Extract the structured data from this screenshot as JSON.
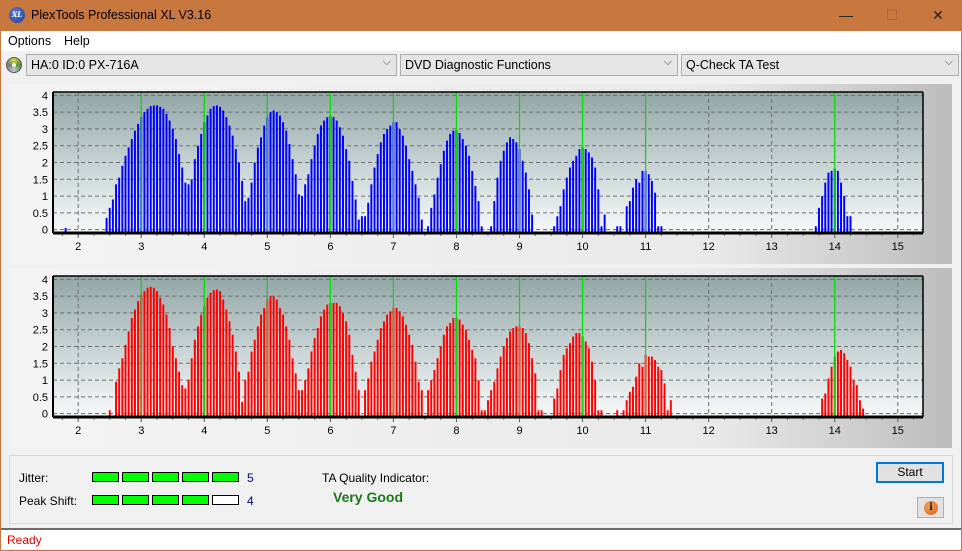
{
  "window": {
    "title": "PlexTools Professional XL V3.16",
    "app_icon_text": "XL",
    "minimize_glyph": "—",
    "maximize_glyph": "☐",
    "close_glyph": "✕"
  },
  "menu": {
    "items": [
      "Options",
      "Help"
    ]
  },
  "toolbar": {
    "drive_select": "HA:0 ID:0  PX-716A",
    "function_select": "DVD Diagnostic Functions",
    "test_select": "Q-Check TA Test",
    "chevron": "⌵"
  },
  "colors": {
    "land_bars": "#0000ff",
    "pit_bars": "#ff0000",
    "reference_lines": "#00e000",
    "quality_text": "#1a7a1a",
    "status_text": "#e00000"
  },
  "bottom": {
    "jitter_label": "Jitter:",
    "jitter_value": "5",
    "jitter_score": 5,
    "peak_shift_label": "Peak Shift:",
    "peak_shift_value": "4",
    "peak_shift_score": 4,
    "meter_max": 5,
    "ta_quality_label": "TA Quality Indicator:",
    "ta_quality_value": "Very Good",
    "start_label": "Start",
    "info_glyph": "i"
  },
  "status": {
    "text": "Ready"
  },
  "chart_data": [
    {
      "type": "bar",
      "name": "upper-ta-histogram",
      "color": "#0000ff",
      "xlim": [
        1.6,
        15.4
      ],
      "ylim": [
        -0.1,
        4.1
      ],
      "x_ticks": [
        "2",
        "3",
        "4",
        "5",
        "6",
        "7",
        "8",
        "9",
        "10",
        "11",
        "12",
        "13",
        "14",
        "15"
      ],
      "y_ticks": [
        "0",
        "0.5",
        "1",
        "1.5",
        "2",
        "2.5",
        "3",
        "3.5",
        "4"
      ],
      "reference_lines": [
        3,
        4,
        5,
        6,
        7,
        8,
        9,
        10,
        11,
        14
      ],
      "grid": true,
      "bar_step": 0.05,
      "peaks": [
        {
          "start": 1.8,
          "values": [
            0.05
          ]
        },
        {
          "start": 2.45,
          "values": [
            0.35,
            0.65,
            0.9,
            1.35,
            1.55,
            1.9,
            2.2,
            2.45,
            2.7,
            2.95,
            3.15,
            3.35,
            3.5,
            3.6,
            3.68,
            3.7,
            3.7,
            3.66,
            3.6,
            3.45,
            3.25,
            3.0,
            2.7,
            2.25,
            1.85,
            1.4,
            1.35,
            1.5,
            2.1,
            2.5,
            2.85,
            3.2,
            3.4,
            3.6,
            3.68,
            3.7,
            3.66,
            3.55,
            3.35,
            3.1,
            2.8,
            2.4,
            2.0,
            1.45,
            0.85,
            0.95,
            1.4,
            2.0,
            2.45,
            2.75,
            3.1,
            3.35,
            3.5,
            3.55,
            3.5,
            3.4,
            3.2,
            2.95,
            2.55,
            2.1,
            1.65,
            1.05,
            0.15
          ]
        },
        {
          "start": 5.55,
          "values": [
            1.0,
            1.35,
            1.65,
            2.1,
            2.5,
            2.85,
            3.1,
            3.25,
            3.35,
            3.38,
            3.35,
            3.25,
            3.05,
            2.8,
            2.4,
            2.05,
            1.45,
            0.9,
            0.3
          ]
        },
        {
          "start": 6.5,
          "values": [
            0.4,
            0.4,
            0.8,
            1.35,
            1.85,
            2.25,
            2.6,
            2.85,
            3.0,
            3.1,
            3.2,
            3.2,
            3.0,
            2.8,
            2.5,
            2.1,
            1.75,
            1.35,
            0.95,
            0.3
          ]
        },
        {
          "start": 7.55,
          "values": [
            0.1,
            0.65,
            1.05,
            1.55,
            1.95,
            2.35,
            2.65,
            2.85,
            2.95,
            2.96,
            2.88,
            2.7,
            2.5,
            2.2,
            1.75,
            1.3,
            0.85,
            0.1
          ]
        },
        {
          "start": 8.55,
          "values": [
            0.1,
            0.85,
            1.55,
            2.05,
            2.35,
            2.6,
            2.75,
            2.7,
            2.6,
            2.4,
            2.05,
            1.7,
            1.2,
            0.45
          ]
        },
        {
          "start": 9.55,
          "values": [
            0.1,
            0.4,
            0.7,
            1.2,
            1.55,
            1.85,
            2.05,
            2.2,
            2.4,
            2.45,
            2.4,
            2.3,
            2.15,
            1.85,
            1.2,
            0.1,
            0.45
          ]
        },
        {
          "start": 10.55,
          "values": [
            0.1,
            0.1
          ]
        },
        {
          "start": 10.7,
          "values": [
            0.7,
            0.85,
            1.25,
            1.5,
            1.4,
            1.75,
            1.75,
            1.65,
            1.45,
            1.1,
            0.1,
            0.1
          ]
        },
        {
          "start": 13.7,
          "values": [
            0.1,
            0.65,
            1.0,
            1.4,
            1.7,
            1.75,
            1.82,
            1.75,
            1.4,
            1.0,
            0.4,
            0.4
          ]
        }
      ]
    },
    {
      "type": "bar",
      "name": "lower-ta-histogram",
      "color": "#ff0000",
      "xlim": [
        1.6,
        15.4
      ],
      "ylim": [
        -0.1,
        4.1
      ],
      "x_ticks": [
        "2",
        "3",
        "4",
        "5",
        "6",
        "7",
        "8",
        "9",
        "10",
        "11",
        "12",
        "13",
        "14",
        "15"
      ],
      "y_ticks": [
        "0",
        "0.5",
        "1",
        "1.5",
        "2",
        "2.5",
        "3",
        "3.5",
        "4"
      ],
      "reference_lines": [
        3,
        4,
        5,
        6,
        7,
        8,
        9,
        10,
        11,
        14
      ],
      "grid": true,
      "bar_step": 0.05,
      "peaks": [
        {
          "start": 2.5,
          "values": [
            0.1
          ]
        },
        {
          "start": 2.6,
          "values": [
            0.95,
            1.35,
            1.65,
            2.05,
            2.45,
            2.85,
            3.1,
            3.35,
            3.55,
            3.65,
            3.75,
            3.78,
            3.75,
            3.65,
            3.45,
            3.25,
            2.95,
            2.55,
            2.0,
            1.65,
            1.25,
            0.85,
            0.75,
            1.0,
            1.65,
            2.2,
            2.6,
            2.95,
            3.2,
            3.45,
            3.6,
            3.68,
            3.7,
            3.65,
            3.4,
            3.1,
            2.75,
            2.35,
            1.85,
            1.25,
            0.35,
            1.0,
            1.25,
            1.85,
            2.2,
            2.6,
            2.95,
            3.15,
            3.4,
            3.5,
            3.5,
            3.4,
            3.15,
            2.95,
            2.6,
            2.2,
            1.65,
            1.2,
            0.7,
            0.1
          ]
        },
        {
          "start": 5.55,
          "values": [
            0.7,
            1.0,
            1.35,
            1.85,
            2.25,
            2.55,
            2.9,
            3.1,
            3.25,
            3.3,
            3.3,
            3.3,
            3.2,
            3.0,
            2.75,
            2.35,
            1.75,
            1.25,
            0.7
          ]
        },
        {
          "start": 6.55,
          "values": [
            0.7,
            1.05,
            1.55,
            1.85,
            2.2,
            2.55,
            2.75,
            2.95,
            3.05,
            3.15,
            3.15,
            3.05,
            2.9,
            2.65,
            2.35,
            2.05,
            1.55,
            0.95,
            0.7
          ]
        },
        {
          "start": 7.55,
          "values": [
            0.7,
            1.0,
            1.3,
            1.65,
            2.0,
            2.35,
            2.6,
            2.7,
            2.85,
            2.85,
            2.8,
            2.65,
            2.5,
            2.2,
            1.9,
            1.65,
            1.0,
            0.1,
            0.1,
            0.4
          ]
        },
        {
          "start": 8.55,
          "values": [
            0.7,
            0.95,
            1.35,
            1.7,
            2.0,
            2.25,
            2.45,
            2.55,
            2.6,
            2.6,
            2.55,
            2.4,
            2.1,
            1.65,
            1.2,
            0.1,
            0.1
          ]
        },
        {
          "start": 9.55,
          "values": [
            0.45,
            0.75,
            1.3,
            1.75,
            1.95,
            2.1,
            2.3,
            2.4,
            2.4,
            2.3,
            2.15,
            1.95,
            1.55,
            1.0,
            0.1,
            0.1
          ]
        },
        {
          "start": 10.55,
          "values": [
            0.1
          ]
        },
        {
          "start": 10.65,
          "values": [
            0.1,
            0.4,
            0.65,
            0.8,
            1.1,
            1.5,
            1.4,
            1.75,
            1.7,
            1.7,
            1.6,
            1.4,
            1.3,
            0.9,
            0.1,
            0.4
          ]
        },
        {
          "start": 13.8,
          "values": [
            0.45,
            0.6,
            1.05,
            1.4,
            1.7,
            1.85,
            1.9,
            1.8,
            1.6,
            1.4,
            1.0,
            0.85,
            0.4,
            0.15
          ]
        }
      ]
    }
  ]
}
